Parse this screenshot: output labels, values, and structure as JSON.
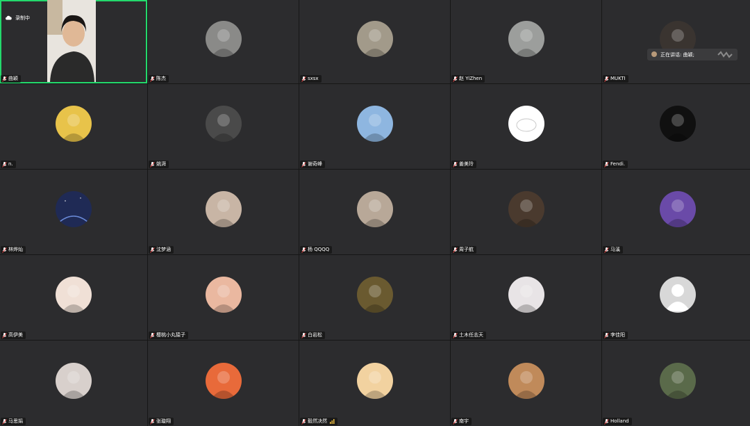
{
  "recording": {
    "label": "录制中"
  },
  "speaking": {
    "label": "正在讲话: 曲颖;"
  },
  "participants": [
    {
      "name": "曲颖",
      "avatar": "video-feed",
      "speaker": true,
      "video": true
    },
    {
      "name": "陈杰",
      "avatar": "photo-street",
      "color": "#8a8a88"
    },
    {
      "name": "sxsx",
      "avatar": "photo-blurry-room",
      "color": "#a29a8a"
    },
    {
      "name": "赵 YiZhen",
      "avatar": "photo-stairs",
      "color": "#9c9e9c"
    },
    {
      "name": "MUKTI",
      "avatar": "photo-dark-room",
      "color": "#3a3430"
    },
    {
      "name": "n.",
      "avatar": "sponge-cartoon",
      "color": "#e8c34a"
    },
    {
      "name": "姚湃",
      "avatar": "photo-bw-person",
      "color": "#4a4a4a"
    },
    {
      "name": "谢奇峰",
      "avatar": "blue-art",
      "color": "#8eb6e0"
    },
    {
      "name": "姜美玲",
      "avatar": "white-bunny-drawing",
      "color": "#ffffff"
    },
    {
      "name": "Fendi.",
      "avatar": "black-cartoon-face",
      "color": "#101010"
    },
    {
      "name": "林烨灿",
      "avatar": "night-sky",
      "color": "#1f2a55"
    },
    {
      "name": "沈梦涵",
      "avatar": "photo-girl",
      "color": "#c8b5a5"
    },
    {
      "name": "杨 QQQQ",
      "avatar": "photo-cat",
      "color": "#b8a898"
    },
    {
      "name": "周子航",
      "avatar": "photo-dog",
      "color": "#4a3a2e"
    },
    {
      "name": "马溪",
      "avatar": "basketball-player",
      "color": "#6a4aa8"
    },
    {
      "name": "高伊美",
      "avatar": "bunny-cartoon",
      "color": "#f0e0d6"
    },
    {
      "name": "樱桃小丸猿子",
      "avatar": "cartoon-girl",
      "color": "#eab8a0"
    },
    {
      "name": "白岩松",
      "avatar": "anime-scene",
      "color": "#6a5a30"
    },
    {
      "name": "土木任志天",
      "avatar": "photo-white-figure",
      "color": "#e8e4e6"
    },
    {
      "name": "李佳阳",
      "avatar": "default-silhouette",
      "color": "#c8c8c8"
    },
    {
      "name": "马思娟",
      "avatar": "photo-girl-bw",
      "color": "#d8d0cc"
    },
    {
      "name": "张璇翔",
      "avatar": "cartoon-character",
      "color": "#e86a3a"
    },
    {
      "name": "毅然决然",
      "avatar": "anime-girl",
      "color": "#f2d2a0",
      "audio_bars": true
    },
    {
      "name": "南宇",
      "avatar": "photo-boy",
      "color": "#c08a5a"
    },
    {
      "name": "Holland",
      "avatar": "photo-person-outdoor",
      "color": "#5a6a4a"
    }
  ]
}
